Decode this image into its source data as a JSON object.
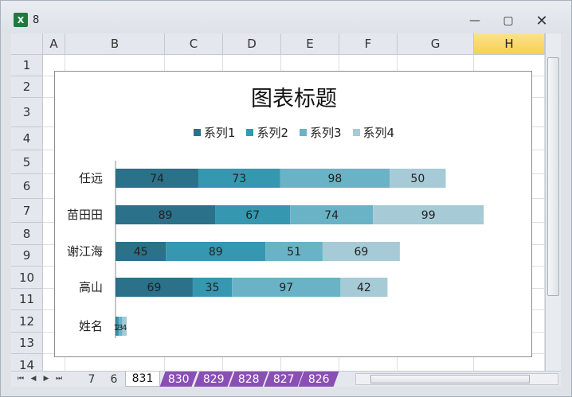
{
  "window": {
    "title": "8",
    "app_icon_glyph": "X",
    "buttons": {
      "minimize": "—",
      "maximize": "▢",
      "close": "✕"
    }
  },
  "sheet": {
    "columns": [
      "A",
      "B",
      "C",
      "D",
      "E",
      "F",
      "G",
      "H"
    ],
    "selected_column": "H",
    "rows": [
      "1",
      "2",
      "3",
      "4",
      "5",
      "6",
      "7",
      "8",
      "9",
      "10",
      "11",
      "12",
      "13",
      "14"
    ]
  },
  "chart_data": {
    "type": "bar",
    "orientation": "horizontal",
    "stacked": true,
    "title": "图表标题",
    "categories": [
      "任远",
      "苗田田",
      "谢江海",
      "高山",
      "姓名"
    ],
    "series": [
      {
        "name": "系列1",
        "values": [
          74,
          89,
          45,
          69,
          1
        ],
        "color": "#2a7189"
      },
      {
        "name": "系列2",
        "values": [
          73,
          67,
          89,
          35,
          2
        ],
        "color": "#3597b0"
      },
      {
        "name": "系列3",
        "values": [
          98,
          74,
          51,
          97,
          3
        ],
        "color": "#6ab3c6"
      },
      {
        "name": "系列4",
        "values": [
          50,
          99,
          69,
          42,
          4
        ],
        "color": "#a6cad6"
      }
    ],
    "xlim": [
      0,
      340
    ],
    "legend_position": "top",
    "data_labels": true,
    "grid": false
  },
  "tabs": {
    "nav": [
      "⏮",
      "◀",
      "▶",
      "⏭"
    ],
    "items": [
      "7",
      "6",
      "831",
      "830",
      "829",
      "828",
      "827",
      "826"
    ],
    "active": "831"
  },
  "colors": {
    "sheet_tab_accent": "#8a4fb5",
    "selected_header": "#f7cf55"
  }
}
